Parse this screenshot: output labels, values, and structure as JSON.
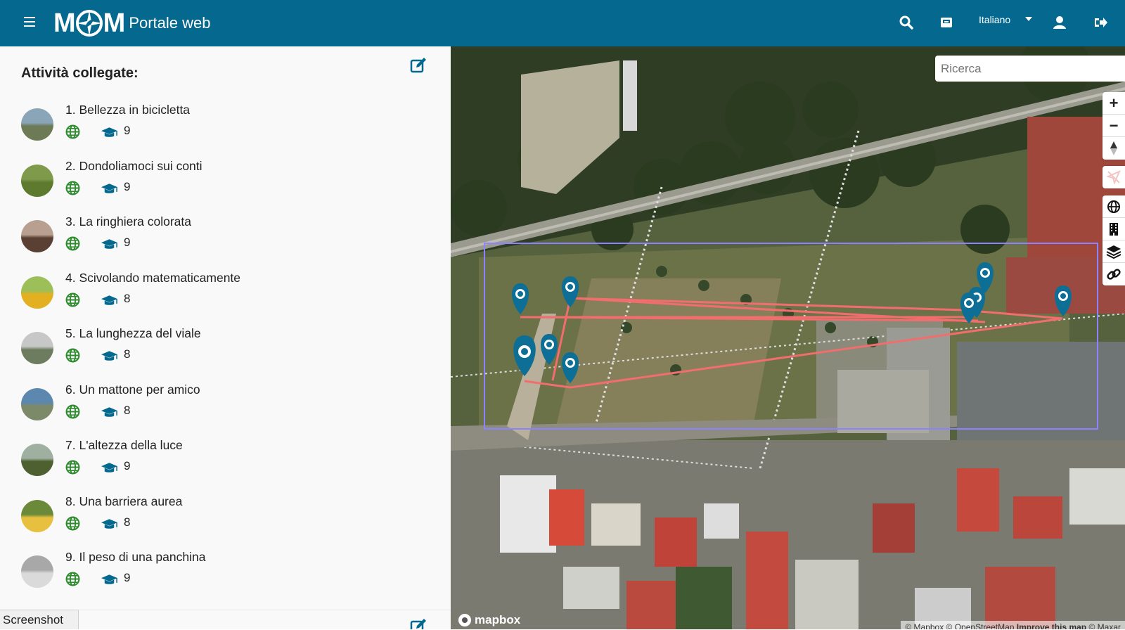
{
  "header": {
    "logo_text": "MCM",
    "title": "Portale web",
    "language": "Italiano"
  },
  "sidebar": {
    "title": "Attività collegate:",
    "activities": [
      {
        "label": "1. Bellezza in bicicletta",
        "count": "9"
      },
      {
        "label": "2. Dondoliamoci sui conti",
        "count": "9"
      },
      {
        "label": "3. La ringhiera colorata",
        "count": "9"
      },
      {
        "label": "4. Scivolando matematicamente",
        "count": "8"
      },
      {
        "label": "5. La lunghezza del viale",
        "count": "8"
      },
      {
        "label": "6. Un mattone per amico",
        "count": "8"
      },
      {
        "label": "7. L'altezza della luce",
        "count": "9"
      },
      {
        "label": "8. Una barriera aurea",
        "count": "8"
      },
      {
        "label": "9. Il peso di una panchina",
        "count": "9"
      }
    ]
  },
  "map": {
    "search_placeholder": "Ricerca",
    "mapbox_label": "mapbox",
    "attribution_prefix": "© Mapbox © OpenStreetMap ",
    "attribution_link": "Improve this map",
    "attribution_suffix": " © Maxar"
  },
  "overlay_tag": "Screenshot",
  "colors": {
    "header": "#05688f",
    "accent": "#05688f",
    "globe": "#2e8b2e",
    "route": "#f26d6d",
    "selection": "#8c82ff"
  },
  "icons": {
    "menu": "hamburger-icon",
    "search": "search-icon",
    "inbox": "inbox-icon",
    "user": "user-icon",
    "logout": "logout-icon",
    "edit": "edit-icon",
    "globe": "globe-icon",
    "cap": "graduation-cap-icon"
  }
}
